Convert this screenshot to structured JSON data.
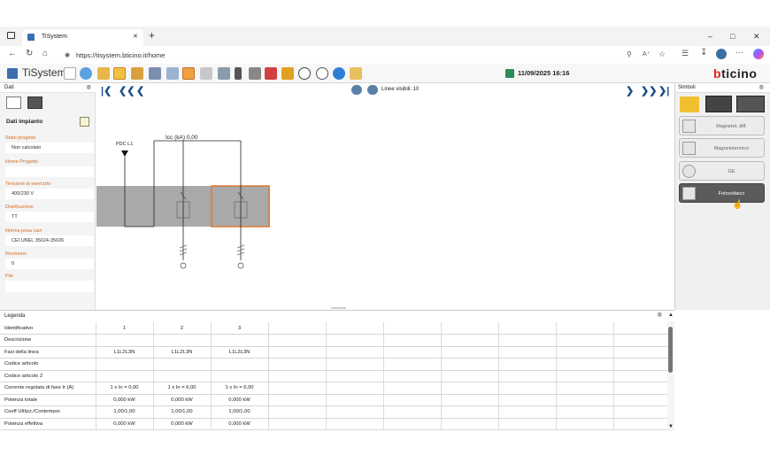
{
  "browser": {
    "tab_title": "TiSystem",
    "url": "https://tisystem.bticino.it/home",
    "min_btn": "–",
    "max_btn": "□",
    "close_btn": "✕",
    "new_tab": "+",
    "tab_close": "✕"
  },
  "app": {
    "title": "TiSystem",
    "datetime": "11/09/2025 16:16",
    "brand_a": "b",
    "brand_b": "ticino"
  },
  "left_panel": {
    "header": "Dati",
    "section_title": "Dati impianto",
    "fields": [
      {
        "label": "Stato progetto",
        "value": "Non calcolato"
      },
      {
        "label": "Nome Progetto",
        "value": ""
      },
      {
        "label": "Tensione di esercizio",
        "value": "400/230 V"
      },
      {
        "label": "Distribuzione",
        "value": "TT"
      },
      {
        "label": "Norma posa cavi",
        "value": "CEI UNEL 35024-35026"
      },
      {
        "label": "Revisione",
        "value": "0"
      },
      {
        "label": "File",
        "value": ""
      }
    ]
  },
  "canvas": {
    "visible_lines": "Linee visibili: 10",
    "pdc_label": "PDC L1",
    "icc_label": "Icc (kA) 0,00"
  },
  "right_panel": {
    "header": "Simboli",
    "symbols": [
      {
        "label": "Magnetot. diff.",
        "selected": false
      },
      {
        "label": "Magnetotermico",
        "selected": false
      },
      {
        "label": "GE",
        "selected": false
      },
      {
        "label": "Fotovoltaico",
        "selected": true
      }
    ]
  },
  "legend": {
    "title": "Legenda",
    "columns": [
      "1",
      "2",
      "3"
    ],
    "rows": [
      {
        "label": "Identificativo",
        "values": [
          "1",
          "2",
          "3"
        ]
      },
      {
        "label": "Descrizione",
        "values": [
          "",
          "",
          ""
        ]
      },
      {
        "label": "Fasi della linea",
        "values": [
          "L1L2L3N",
          "L1L2L3N",
          "L1L2L3N"
        ]
      },
      {
        "label": "Codice articolo",
        "values": [
          "",
          "",
          ""
        ]
      },
      {
        "label": "Codice articolo 2",
        "values": [
          "",
          "",
          ""
        ]
      },
      {
        "label": "Corrente regolata di fase Ir (A)",
        "values": [
          "1 x In = 0,00",
          "1 x In = 6,00",
          "1 x In = 6,00"
        ]
      },
      {
        "label": "Potenza totale",
        "values": [
          "0,000 kW",
          "0,000 kW",
          "0,000 kW"
        ]
      },
      {
        "label": "Coeff Utilizz./Contempor.",
        "values": [
          "1,00/1,00",
          "1,00/1,00",
          "1,00/1,00"
        ]
      },
      {
        "label": "Potenza effettiva",
        "values": [
          "0,000 kW",
          "0,000 kW",
          "0,000 kW"
        ]
      }
    ]
  },
  "colors": {
    "accent_orange": "#d96b1f",
    "nav_blue": "#1a4d85",
    "brand_red": "#e1211b",
    "selected_gray": "#5b5b5b"
  }
}
